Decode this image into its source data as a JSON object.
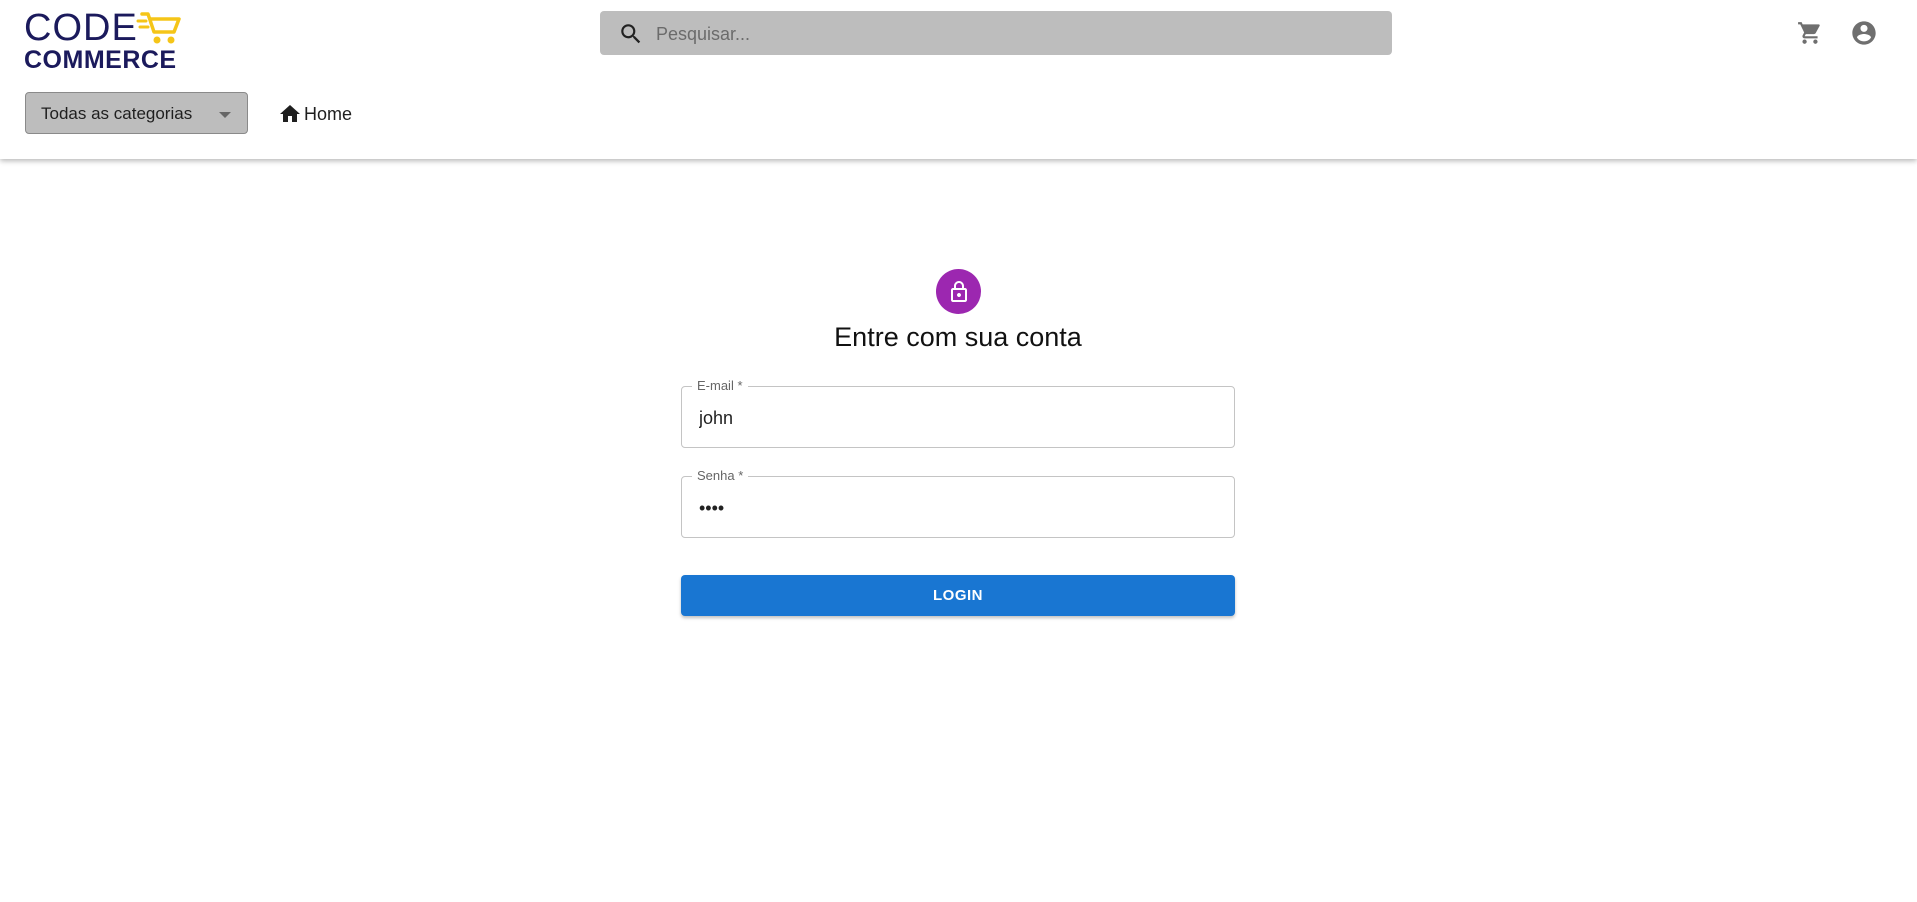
{
  "brand": {
    "logo_line1": "CODE",
    "logo_line2": "COMMERCE",
    "primary_color": "#1b1a5c",
    "cart_accent_color": "#f5c518"
  },
  "header": {
    "search": {
      "placeholder": "Pesquisar...",
      "icon": "search-icon"
    },
    "actions": [
      {
        "name": "cart",
        "icon": "shopping-cart-icon"
      },
      {
        "name": "account",
        "icon": "account-circle-icon"
      }
    ],
    "category_select": {
      "selected": "Todas as categorias",
      "icon": "arrow-drop-down-icon"
    },
    "nav": {
      "home_label": "Home",
      "home_icon": "home-icon"
    }
  },
  "login": {
    "avatar_icon": "lock-icon",
    "avatar_color": "#9c27b0",
    "title": "Entre com sua conta",
    "email": {
      "label": "E-mail *",
      "value": "john"
    },
    "password": {
      "label": "Senha *",
      "value": "••••"
    },
    "submit_label": "LOGIN",
    "submit_color": "#1976d2"
  }
}
